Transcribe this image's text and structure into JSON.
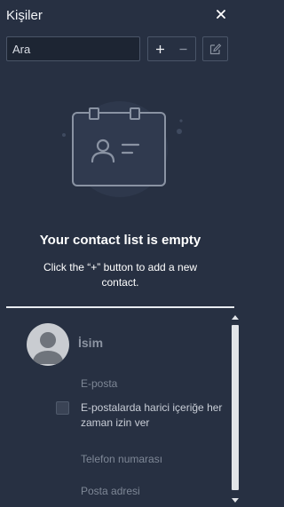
{
  "header": {
    "title": "Kişiler",
    "close_icon": "close-icon"
  },
  "toolbar": {
    "search_placeholder": "Ara",
    "add_label": "+",
    "remove_label": "−",
    "edit_icon": "edit-icon"
  },
  "empty_state": {
    "title": "Your contact list is empty",
    "description": "Click the “+” button to add a new contact."
  },
  "form": {
    "name_label": "İsim",
    "email_label": "E-posta",
    "allow_external_label": "E-postalarda harici içeriğe her zaman izin ver",
    "allow_external_checked": false,
    "phone_label": "Telefon numarası",
    "address_label": "Posta adresi"
  },
  "colors": {
    "background": "#273042",
    "accent_line": "#e8ebf0",
    "muted_text": "#7e8796"
  }
}
